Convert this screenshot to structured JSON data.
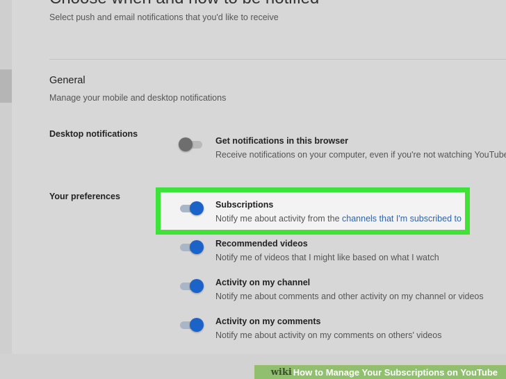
{
  "header": {
    "cut_heading": "Choose when and how to be notified",
    "subtitle": "Select push and email notifications that you'd like to receive"
  },
  "general": {
    "title": "General",
    "description": "Manage your mobile and desktop notifications"
  },
  "desktop_notifications": {
    "label": "Desktop notifications",
    "setting": {
      "title": "Get notifications in this browser",
      "description": "Receive notifications on your computer, even if you're not watching YouTube",
      "enabled": false
    }
  },
  "preferences": {
    "label": "Your preferences",
    "subscriptions": {
      "title": "Subscriptions",
      "description_prefix": "Notify me about activity from the ",
      "description_link": "channels that I'm subscribed to",
      "enabled": true
    },
    "recommended": {
      "title": "Recommended videos",
      "description": "Notify me of videos that I might like based on what I watch",
      "enabled": true
    },
    "channel_activity": {
      "title": "Activity on my channel",
      "description": "Notify me about comments and other activity on my channel or videos",
      "enabled": true
    },
    "comments_activity": {
      "title": "Activity on my comments",
      "description": "Notify me about activity on my comments on others' videos",
      "enabled": true
    }
  },
  "colors": {
    "highlight": "#3ee23a",
    "toggle_on": "#1b63c9",
    "link": "#2f63a8"
  },
  "watermark": {
    "brand": "wiki",
    "text": "How to Manage Your Subscriptions on YouTube"
  }
}
